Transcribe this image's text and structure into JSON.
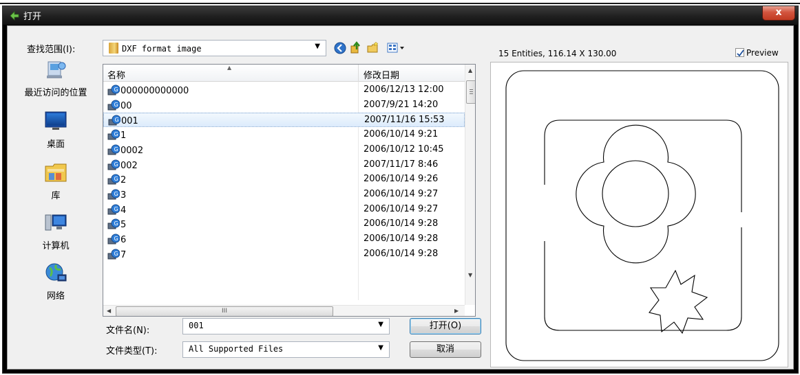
{
  "window": {
    "title": "打开",
    "close_glyph": "x"
  },
  "look_in": {
    "label": "查找范围(I):",
    "value": "DXF format image"
  },
  "places": [
    {
      "label": "最近访问的位置",
      "icon": "recent-places-icon"
    },
    {
      "label": "桌面",
      "icon": "desktop-icon"
    },
    {
      "label": "库",
      "icon": "libraries-icon"
    },
    {
      "label": "计算机",
      "icon": "computer-icon"
    },
    {
      "label": "网络",
      "icon": "network-icon"
    }
  ],
  "file_list": {
    "columns": {
      "name": "名称",
      "modified": "修改日期"
    },
    "rows": [
      {
        "name": "000000000000",
        "date": "2006/12/13 12:00"
      },
      {
        "name": "00",
        "date": "2007/9/21 14:20"
      },
      {
        "name": "001",
        "date": "2007/11/16 15:53",
        "selected": true
      },
      {
        "name": "1",
        "date": "2006/10/14 9:21"
      },
      {
        "name": "0002",
        "date": "2006/10/12 10:45"
      },
      {
        "name": "002",
        "date": "2007/11/17 8:46"
      },
      {
        "name": "2",
        "date": "2006/10/14 9:26"
      },
      {
        "name": "3",
        "date": "2006/10/14 9:27"
      },
      {
        "name": "4",
        "date": "2006/10/14 9:27"
      },
      {
        "name": "5",
        "date": "2006/10/14 9:28"
      },
      {
        "name": "6",
        "date": "2006/10/14 9:28"
      },
      {
        "name": "7",
        "date": "2006/10/14 9:28"
      }
    ],
    "hscroll_grip": "III"
  },
  "file_name": {
    "label": "文件名(N):",
    "value": "001"
  },
  "file_type": {
    "label": "文件类型(T):",
    "value": "All Supported Files"
  },
  "buttons": {
    "open": "打开(O)",
    "cancel": "取消"
  },
  "preview": {
    "info": "15 Entities, 116.14 X 130.00",
    "checkbox_label": "Preview",
    "checked": true
  }
}
